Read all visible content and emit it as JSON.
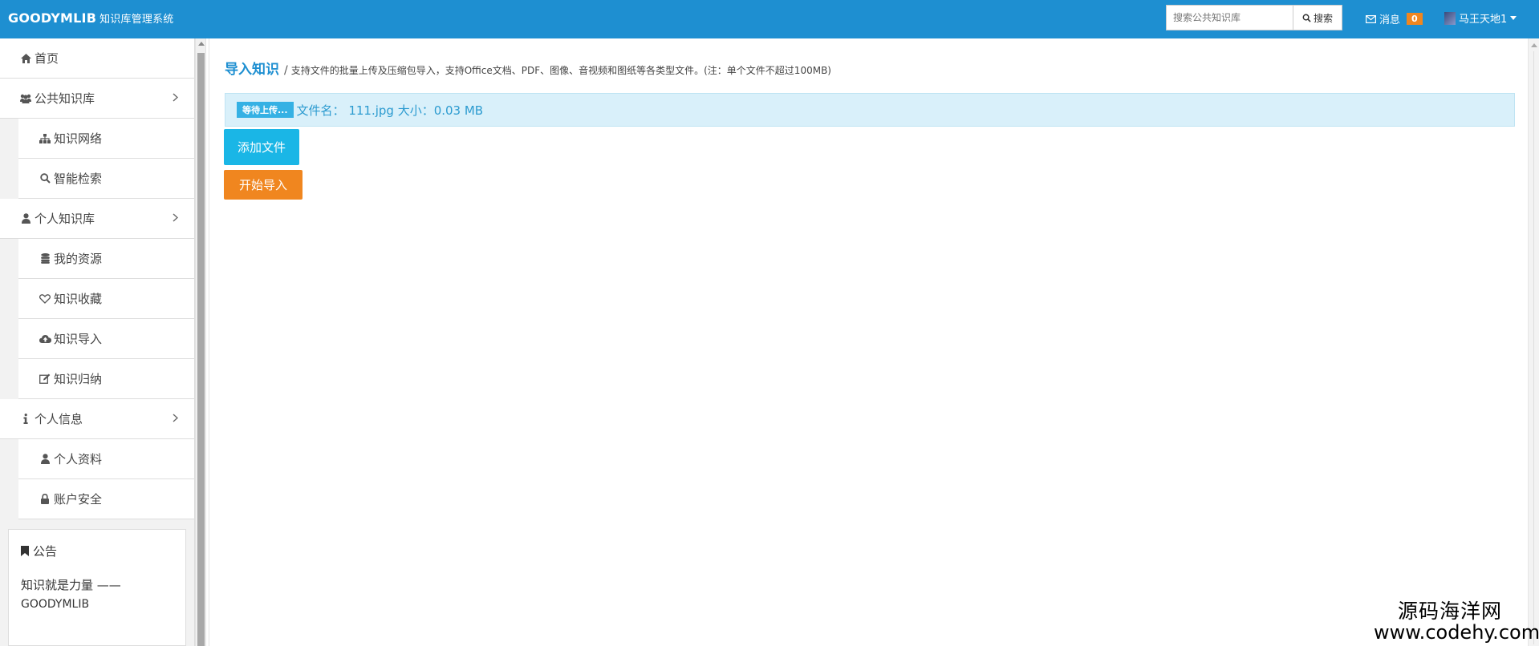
{
  "topbar": {
    "brand": "GOODYMLIB",
    "brand_sub": "知识库管理系统",
    "search_placeholder": "搜索公共知识库",
    "search_button": "搜索",
    "messages_label": "消息",
    "messages_count": "0",
    "user_name": "马王天地1"
  },
  "sidebar": {
    "home": "首页",
    "public_lib": "公共知识库",
    "knowledge_network": "知识网络",
    "smart_search": "智能检索",
    "personal_lib": "个人知识库",
    "my_resources": "我的资源",
    "favorites": "知识收藏",
    "import": "知识导入",
    "summarize": "知识归纳",
    "personal_info": "个人信息",
    "profile": "个人资料",
    "account_security": "账户安全",
    "notice": {
      "title": "公告",
      "line1": "知识就是力量 ——",
      "line2": "GOODYMLIB"
    }
  },
  "main": {
    "title": "导入知识",
    "separator": "/",
    "description": "支持文件的批量上传及压缩包导入，支持Office文档、PDF、图像、音视频和图纸等各类型文件。(注：单个文件不超过100MB)",
    "file": {
      "status": "等待上传...",
      "text": "文件名： 111.jpg 大小：0.03 MB"
    },
    "add_button": "添加文件",
    "start_button": "开始导入"
  },
  "watermark": {
    "line1": "源码海洋网",
    "line2": "www.codehy.com"
  },
  "colors": {
    "topbar": "#1e8fd1",
    "accent_blue": "#1ab6e6",
    "accent_orange": "#f0861f",
    "file_row_bg": "#d9f0fa"
  }
}
